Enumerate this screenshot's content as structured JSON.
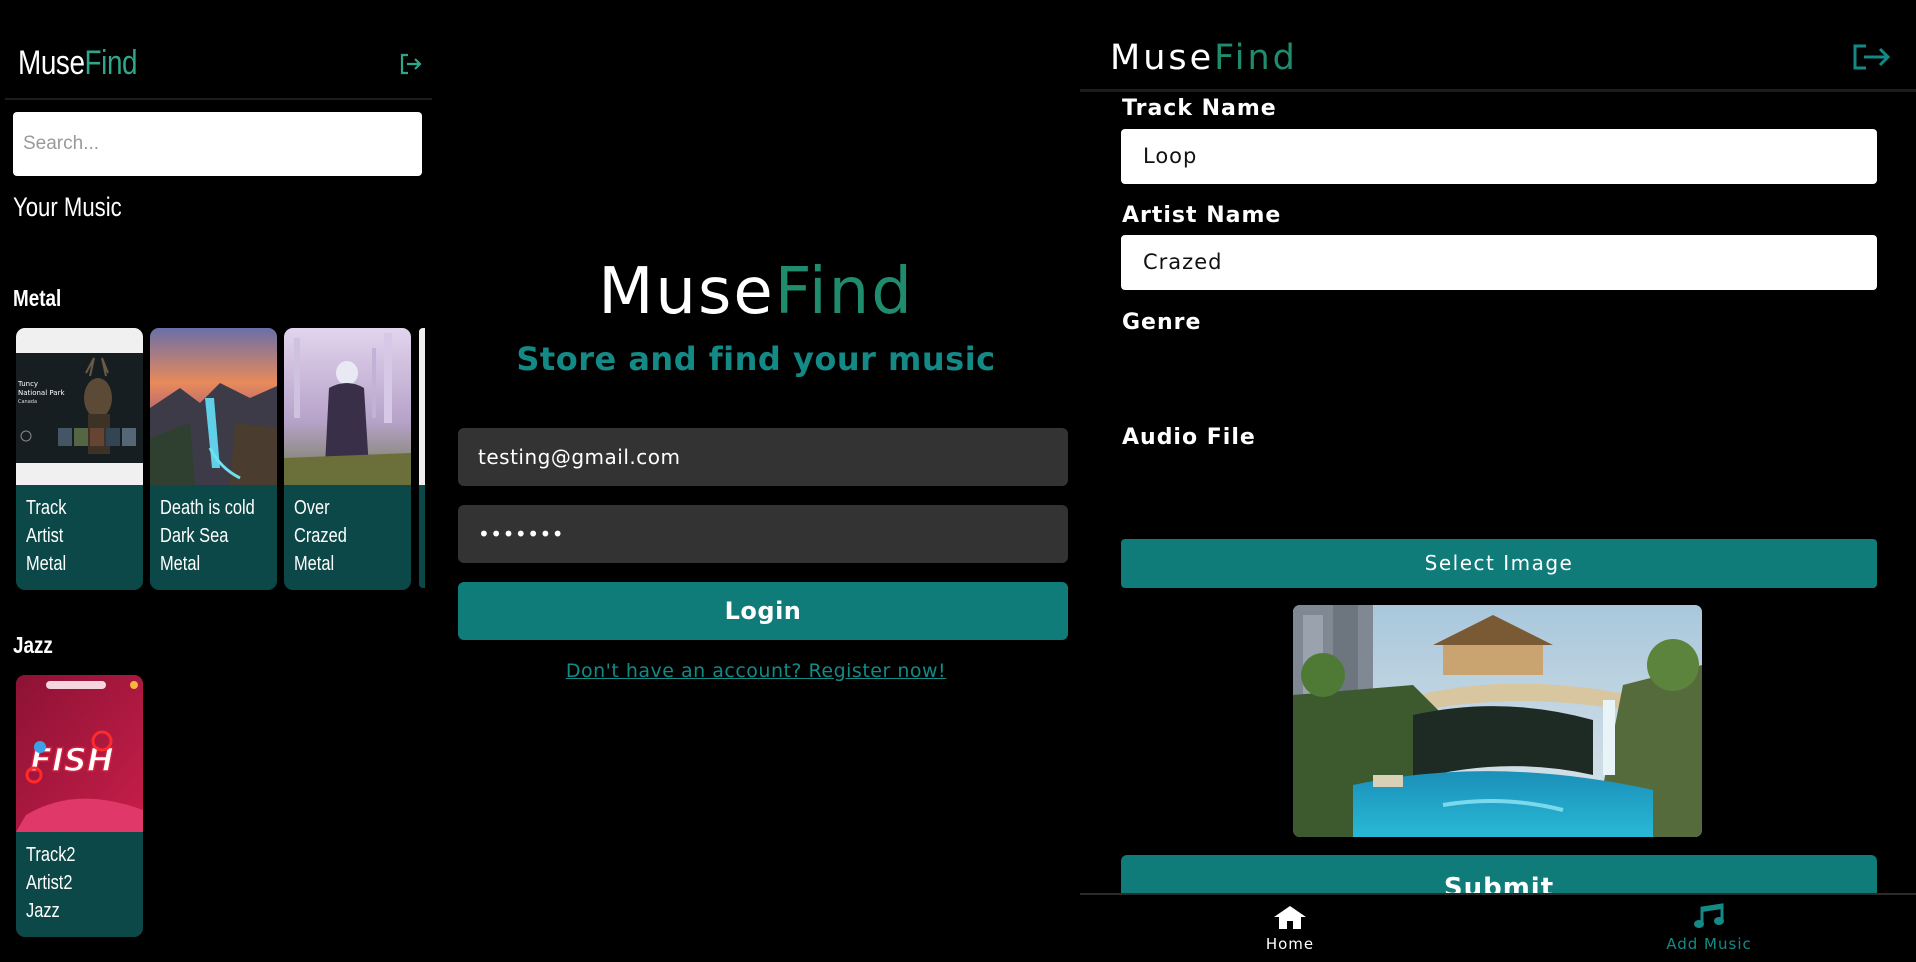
{
  "colors": {
    "accent_teal": "#0f7c79",
    "brand_green": "#1f8c6e",
    "card_bg": "#0c4848",
    "input_dark": "#333333",
    "background": "#000000"
  },
  "browse_screen": {
    "logo": {
      "part1": "Muse",
      "part2": "Find"
    },
    "logout_icon": "logout-icon",
    "search": {
      "placeholder": "Search...",
      "value": ""
    },
    "section_title": "Your Music",
    "genres": [
      {
        "name": "Metal",
        "tracks": [
          {
            "track": "Track",
            "artist": "Artist",
            "genre": "Metal",
            "art": "national-park-website-art"
          },
          {
            "track": "Death is cold",
            "artist": "Dark Sea",
            "genre": "Metal",
            "art": "sunset-waterfall-art"
          },
          {
            "track": "Over",
            "artist": "Crazed",
            "genre": "Metal",
            "art": "white-haired-figure-art"
          }
        ]
      },
      {
        "name": "Jazz",
        "tracks": [
          {
            "track": "Track2",
            "artist": "Artist2",
            "genre": "Jazz",
            "art": "fish-logo-art"
          }
        ]
      }
    ]
  },
  "login_screen": {
    "logo": {
      "part1": "Muse",
      "part2": "Find"
    },
    "tagline": "Store and find your music",
    "email": "testing@gmail.com",
    "password_mask": "•••••••",
    "login_label": "Login",
    "register_link": "Don't have an account? Register now!"
  },
  "add_music_screen": {
    "logo": {
      "part1": "Muse",
      "part2": "Find"
    },
    "logout_icon": "logout-icon",
    "track_name_label": "Track Name",
    "track_name_value": "Loop",
    "artist_name_label": "Artist Name",
    "artist_name_value": "Crazed",
    "genre_label": "Genre",
    "audio_file_label": "Audio File",
    "select_image_label": "Select Image",
    "preview_image": "tropical-waterfall-resort-image",
    "submit_label": "Submit",
    "nav": [
      {
        "label": "Home",
        "icon": "home-icon",
        "active": true
      },
      {
        "label": "Add Music",
        "icon": "music-note-icon",
        "active": false
      }
    ]
  }
}
